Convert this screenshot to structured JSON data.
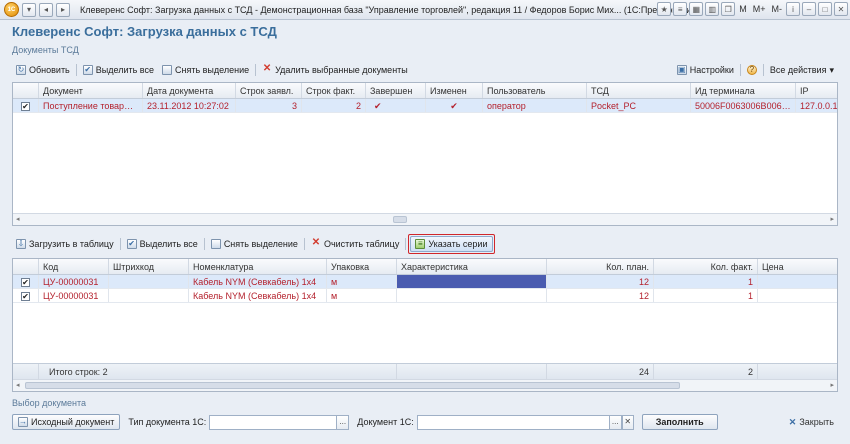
{
  "window": {
    "app_badge": "1С",
    "title": "Клеверенс Софт: Загрузка данных с ТСД - Демонстрационная база \"Управление торговлей\", редакция 11 / Федоров Борис Мих... (1С:Предприятие)",
    "controls": [
      "M",
      "M+",
      "M-"
    ]
  },
  "page": {
    "title": "Клеверенс Софт: Загрузка данных с ТСД"
  },
  "docs_section": {
    "label": "Документы ТСД",
    "toolbar": {
      "refresh": "Обновить",
      "select_all": "Выделить все",
      "deselect": "Снять выделение",
      "delete_selected": "Удалить выбранные документы",
      "settings": "Настройки",
      "help": "?",
      "all_actions": "Все действия"
    },
    "columns": [
      "Документ",
      "Дата документа",
      "Строк заявл.",
      "Строк факт.",
      "Завершен",
      "Изменен",
      "Пользователь",
      "ТСД",
      "Ид терминала",
      "IP"
    ],
    "rows": [
      {
        "document": "Поступление товаров и...",
        "date": "23.11.2012 10:27:02",
        "declared": "3",
        "actual": "2",
        "finished": "✔",
        "changed": "✔",
        "user": "оператор",
        "tsd": "Pocket_PC",
        "terminal_id": "50006F0063006B006500...",
        "ip": "127.0.0.1"
      }
    ]
  },
  "lines_section": {
    "toolbar": {
      "load_to_table": "Загрузить в таблицу",
      "select_all": "Выделить все",
      "deselect": "Снять выделение",
      "clear_table": "Очистить таблицу",
      "specify_series": "Указать серии"
    },
    "columns": [
      "Код",
      "Штрихкод",
      "Номенклатура",
      "Упаковка",
      "Характеристика",
      "Кол. план.",
      "Кол. факт.",
      "Цена"
    ],
    "rows": [
      {
        "code": "ЦУ-00000031",
        "barcode": "",
        "item": "Кабель NYM (Севкабель) 1х4",
        "package": "м",
        "characteristic": "",
        "planned": "12",
        "actual": "1",
        "price": ""
      },
      {
        "code": "ЦУ-00000031",
        "barcode": "",
        "item": "Кабель NYM (Севкабель) 1х4",
        "package": "м",
        "characteristic": "",
        "planned": "12",
        "actual": "1",
        "price": ""
      }
    ],
    "footer": {
      "total_label": "Итого строк: 2",
      "planned_total": "24",
      "actual_total": "2"
    }
  },
  "doc_select": {
    "label": "Выбор документа",
    "source_doc_button": "Исходный документ",
    "doc_type_label": "Тип документа 1С:",
    "doc_type_value": "",
    "doc_label": "Документ 1С:",
    "doc_value": "",
    "fill_button": "Заполнить",
    "close_button": "Закрыть"
  }
}
